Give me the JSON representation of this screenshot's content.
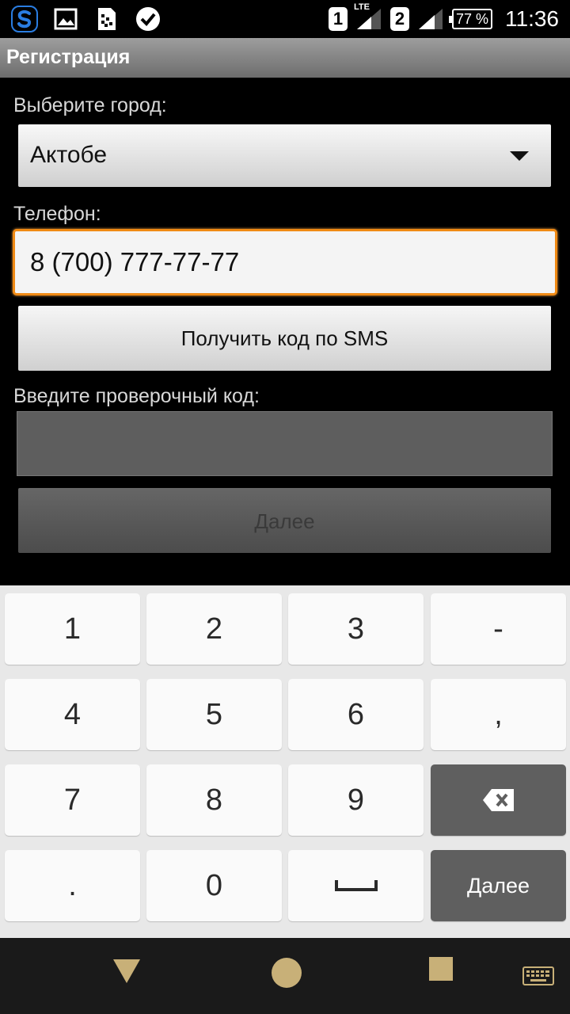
{
  "status_bar": {
    "sim1": "1",
    "network": "LTE",
    "sim2": "2",
    "battery": "77 %",
    "time": "11:36",
    "icons": [
      "app-s-icon",
      "gallery-icon",
      "sim-toolkit-icon",
      "check-circle-icon"
    ]
  },
  "title": "Регистрация",
  "form": {
    "city_label": "Выберите город:",
    "city_value": "Актобе",
    "phone_label": "Телефон:",
    "phone_value": "8 (700) 777-77-77",
    "sms_button": "Получить код по SMS",
    "code_label": "Введите проверочный код:",
    "code_value": "",
    "next_button": "Далее"
  },
  "keyboard": {
    "rows": [
      [
        "1",
        "2",
        "3",
        "-"
      ],
      [
        "4",
        "5",
        "6",
        ","
      ],
      [
        "7",
        "8",
        "9",
        "backspace"
      ],
      [
        ".",
        "0",
        "space",
        "Далее"
      ]
    ],
    "accent_dark": "#5f5f5f"
  },
  "nav_bar": {
    "buttons": [
      "back-icon",
      "home-icon",
      "recents-icon",
      "keyboard-icon"
    ],
    "icon_color": "#c8b078"
  }
}
